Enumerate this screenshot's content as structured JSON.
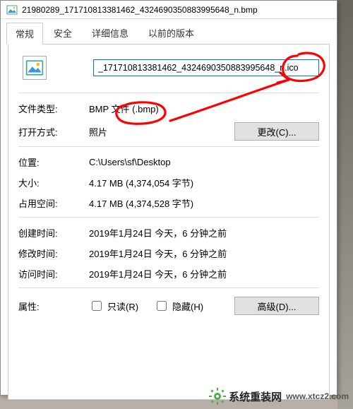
{
  "title": "21980289_171710813381462_4324690350883995648_n.bmp",
  "tabs": [
    "常规",
    "安全",
    "详细信息",
    "以前的版本"
  ],
  "filename": "_171710813381462_4324690350883995648_n.ico",
  "rows": {
    "filetype_label": "文件类型:",
    "filetype_value": "BMP 文件 (.bmp)",
    "openwith_label": "打开方式:",
    "openwith_value": "照片",
    "change_btn": "更改(C)...",
    "location_label": "位置:",
    "location_value": "C:\\Users\\sf\\Desktop",
    "size_label": "大小:",
    "size_value": "4.17 MB (4,374,054 字节)",
    "sizeondisk_label": "占用空间:",
    "sizeondisk_value": "4.17 MB (4,374,528 字节)",
    "created_label": "创建时间:",
    "created_value": "2019年1月24日 今天，6 分钟之前",
    "modified_label": "修改时间:",
    "modified_value": "2019年1月24日 今天，6 分钟之前",
    "accessed_label": "访问时间:",
    "accessed_value": "2019年1月24日 今天，6 分钟之前",
    "attr_label": "属性:",
    "readonly_label": "只读(R)",
    "hidden_label": "隐藏(H)",
    "advanced_btn": "高级(D)..."
  },
  "watermark": {
    "brand": "系统重装网",
    "url": "www.xtcz2.com"
  }
}
